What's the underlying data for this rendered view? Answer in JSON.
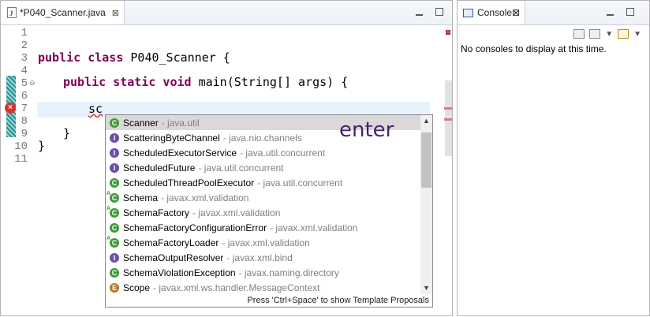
{
  "editor": {
    "tab_title": "*P040_Scanner.java",
    "line_numbers": [
      "1",
      "2",
      "3",
      "4",
      "5",
      "6",
      "7",
      "8",
      "9",
      "10",
      "11"
    ],
    "code": {
      "class_keywords": "public class",
      "class_name": " P040_Scanner {",
      "main_keywords": "public static void",
      "main_rest": " main(String[] args) {",
      "typed": "sc",
      "close_inner": "}",
      "close_outer": "}"
    }
  },
  "autocomplete": {
    "items": [
      {
        "icon": "class-icon",
        "name": "Scanner",
        "pkg": "- java.util",
        "selected": true
      },
      {
        "icon": "interface-icon",
        "name": "ScatteringByteChannel",
        "pkg": "- java.nio.channels"
      },
      {
        "icon": "interface-icon",
        "name": "ScheduledExecutorService",
        "pkg": "- java.util.concurrent"
      },
      {
        "icon": "interface-icon",
        "name": "ScheduledFuture",
        "pkg": "- java.util.concurrent"
      },
      {
        "icon": "class-icon",
        "name": "ScheduledThreadPoolExecutor",
        "pkg": "- java.util.concurrent"
      },
      {
        "icon": "abstract-class-icon",
        "name": "Schema",
        "pkg": "- javax.xml.validation"
      },
      {
        "icon": "abstract-class-icon",
        "name": "SchemaFactory",
        "pkg": "- javax.xml.validation"
      },
      {
        "icon": "class-icon",
        "name": "SchemaFactoryConfigurationError",
        "pkg": "- javax.xml.validation"
      },
      {
        "icon": "abstract-class-icon",
        "name": "SchemaFactoryLoader",
        "pkg": "- javax.xml.validation"
      },
      {
        "icon": "interface-icon",
        "name": "SchemaOutputResolver",
        "pkg": "- javax.xml.bind"
      },
      {
        "icon": "class-icon",
        "name": "SchemaViolationException",
        "pkg": "- javax.naming.directory"
      },
      {
        "icon": "enum-icon",
        "name": "Scope",
        "pkg": "- javax.xml.ws.handler.MessageContext"
      }
    ],
    "status": "Press 'Ctrl+Space' to show Template Proposals"
  },
  "annotation": "enter",
  "console": {
    "tab_title": "Console",
    "message": "No consoles to display at this time."
  }
}
